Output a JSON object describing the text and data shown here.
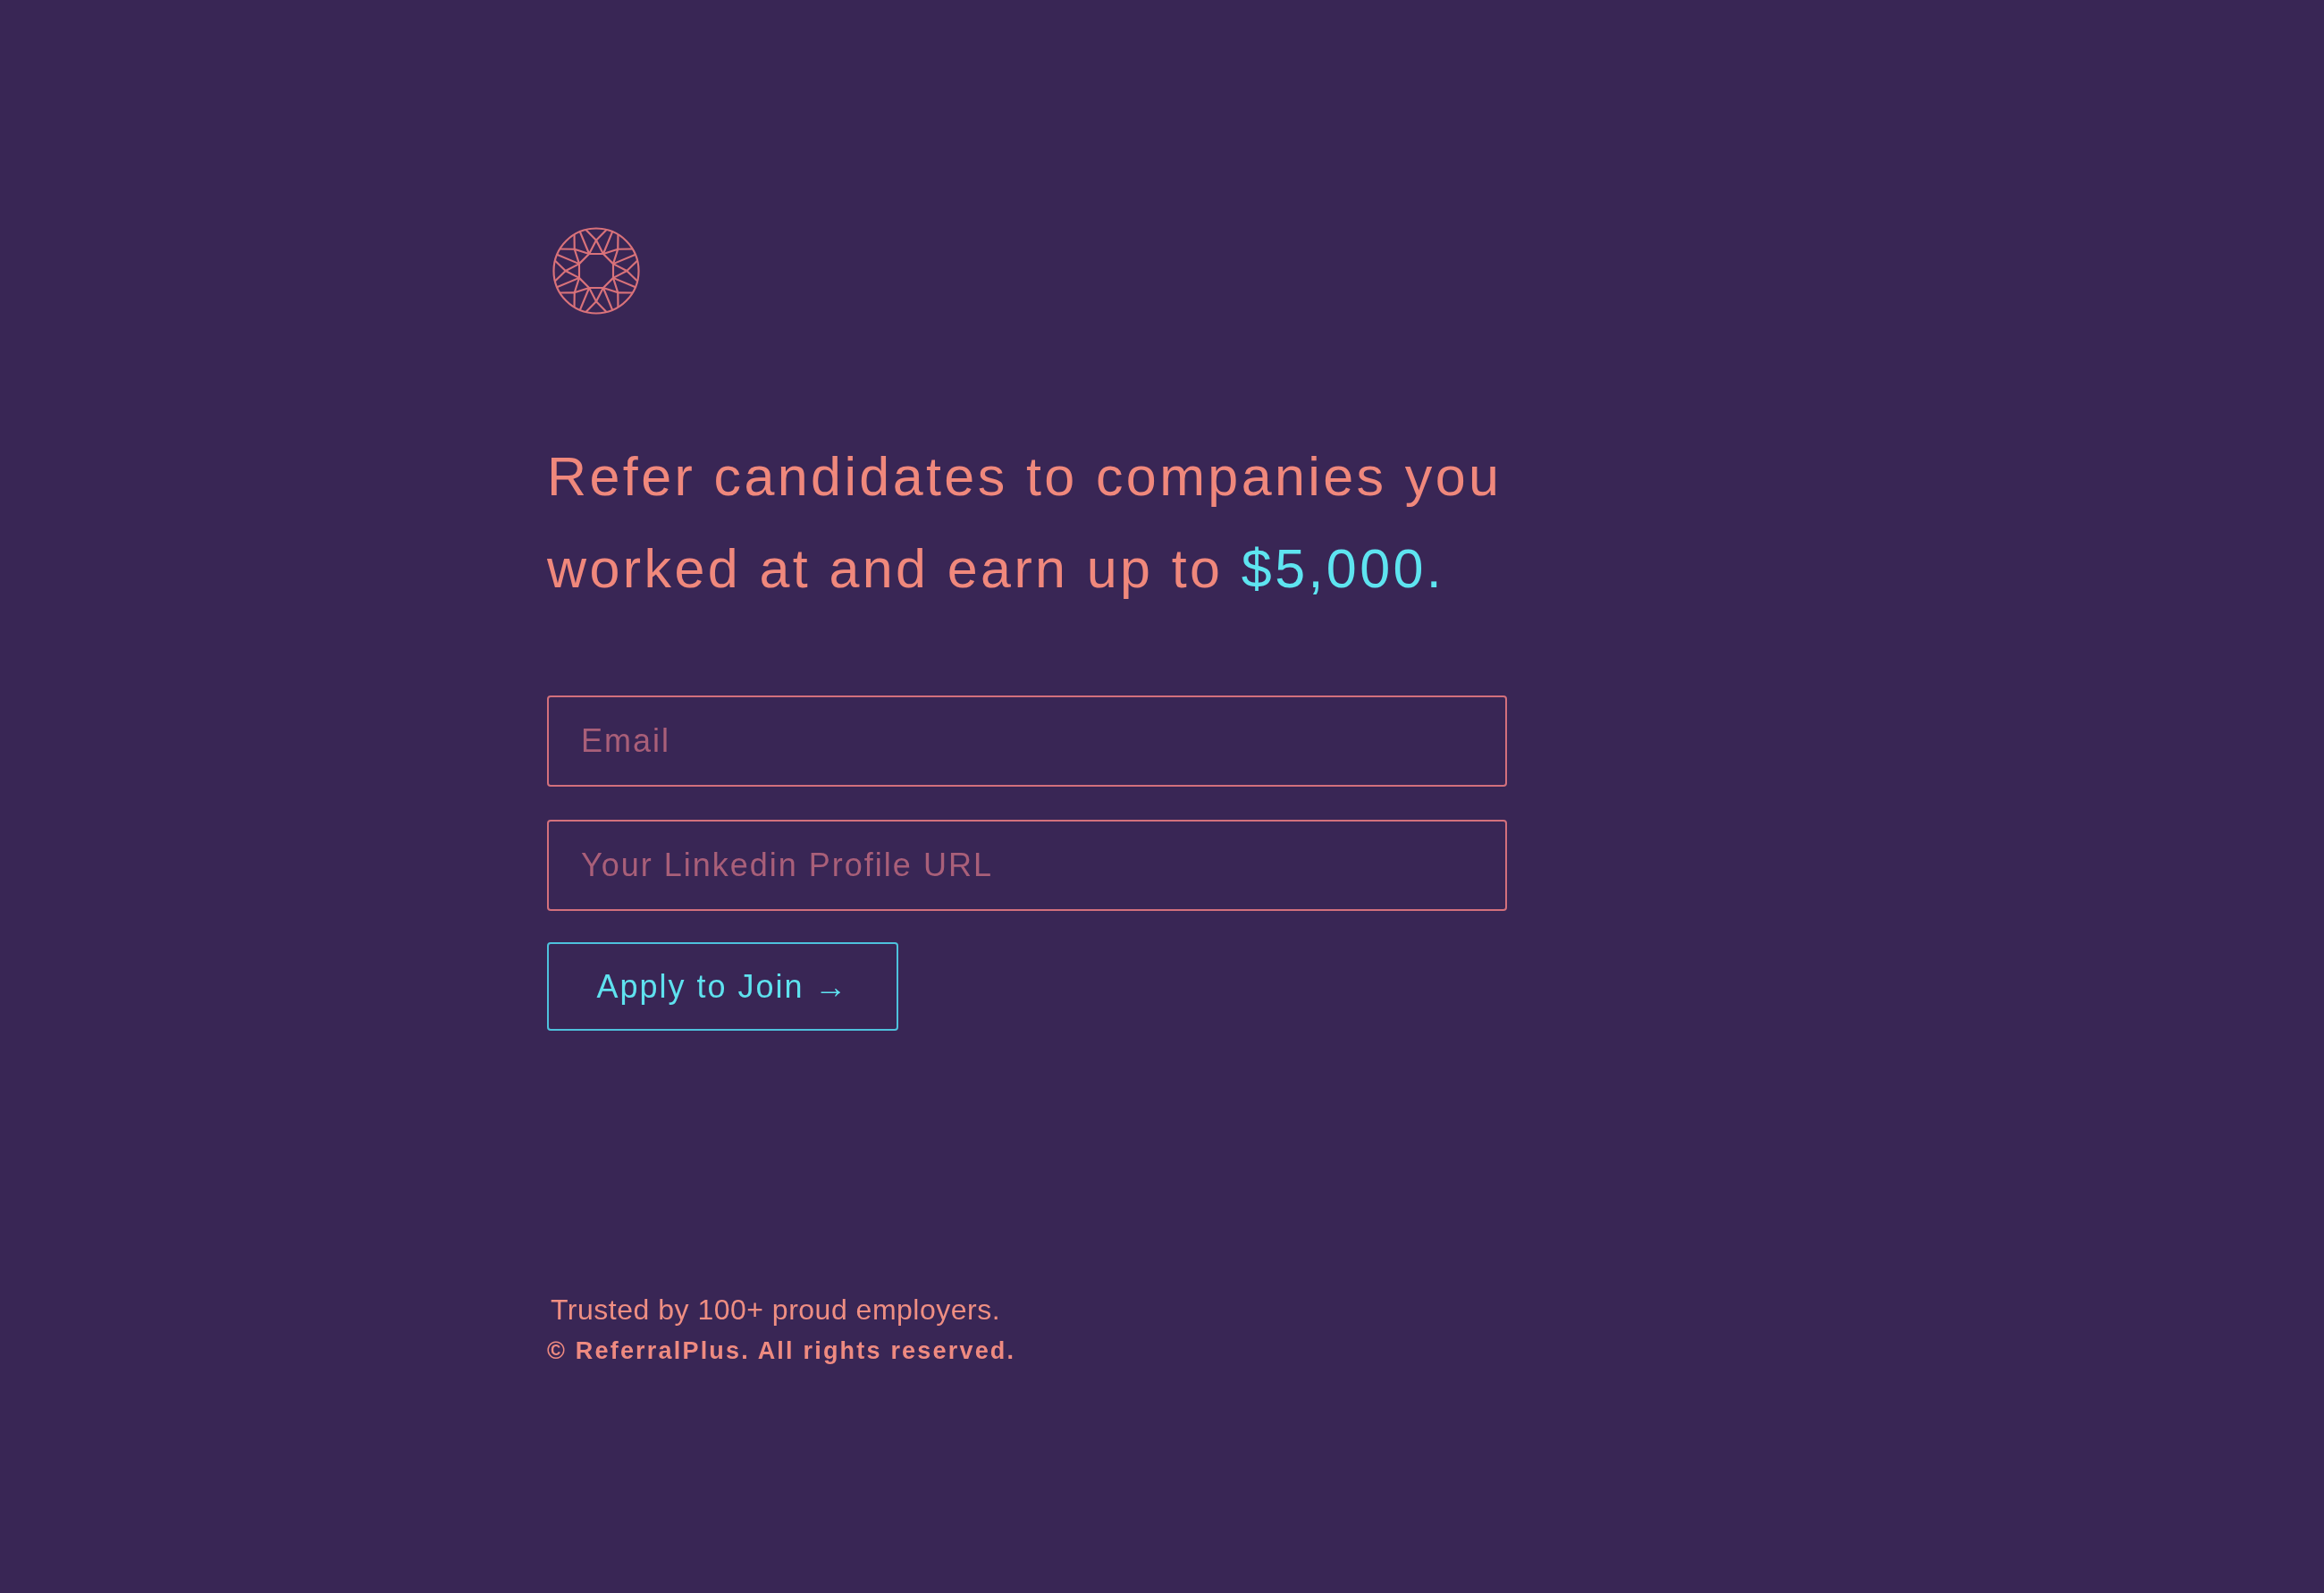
{
  "headline": {
    "text": "Refer candidates to companies you worked at and earn up to",
    "highlight": "$5,000."
  },
  "signup_form": {
    "fields": [
      {
        "placeholder": "Email"
      },
      {
        "placeholder": "Your Linkedin Profile URL"
      }
    ],
    "submit_button": "Apply to Join →"
  },
  "footer": {
    "tagline": "Trusted by 100+ proud employers.",
    "copyright": "© ReferralPlus. All rights reserved."
  }
}
